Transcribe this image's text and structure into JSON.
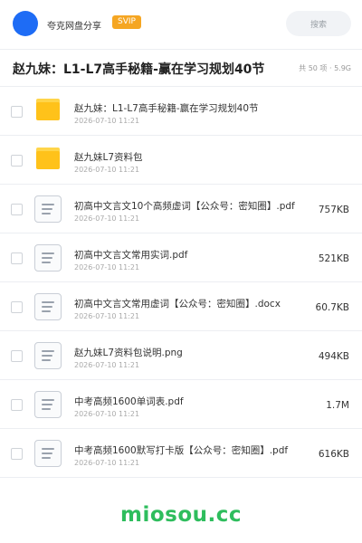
{
  "header": {
    "app_name": "夸克网盘分享",
    "badge": "SVIP",
    "search_label": "搜索",
    "avatar_color": "#1e6cf5"
  },
  "share": {
    "title": "赵九妹：L1-L7高手秘籍-赢在学习规划40节",
    "meta": "共 50 项 · 5.9G"
  },
  "files": [
    {
      "name": "赵九妹：L1-L7高手秘籍-赢在学习规划40节",
      "date": "2026-07-10 11:21",
      "size": "",
      "icon": "folder-icon"
    },
    {
      "name": "赵九妹L7资料包",
      "date": "2026-07-10 11:21",
      "size": "",
      "icon": "folder-icon"
    },
    {
      "name": "初高中文言文10个高频虚词【公众号：密知圈】.pdf",
      "date": "2026-07-10 11:21",
      "size": "757KB",
      "icon": "document-icon"
    },
    {
      "name": "初高中文言文常用实词.pdf",
      "date": "2026-07-10 11:21",
      "size": "521KB",
      "icon": "document-icon"
    },
    {
      "name": "初高中文言文常用虚词【公众号：密知圈】.docx",
      "date": "2026-07-10 11:21",
      "size": "60.7KB",
      "icon": "document-icon"
    },
    {
      "name": "赵九妹L7资料包说明.png",
      "date": "2026-07-10 11:21",
      "size": "494KB",
      "icon": "document-icon"
    },
    {
      "name": "中考高频1600单词表.pdf",
      "date": "2026-07-10 11:21",
      "size": "1.7M",
      "icon": "document-icon"
    },
    {
      "name": "中考高频1600默写打卡版【公众号：密知圈】.pdf",
      "date": "2026-07-10 11:21",
      "size": "616KB",
      "icon": "document-icon"
    }
  ],
  "footer": {
    "watermark": "miosou.cc",
    "color": "#2ebd5d"
  }
}
